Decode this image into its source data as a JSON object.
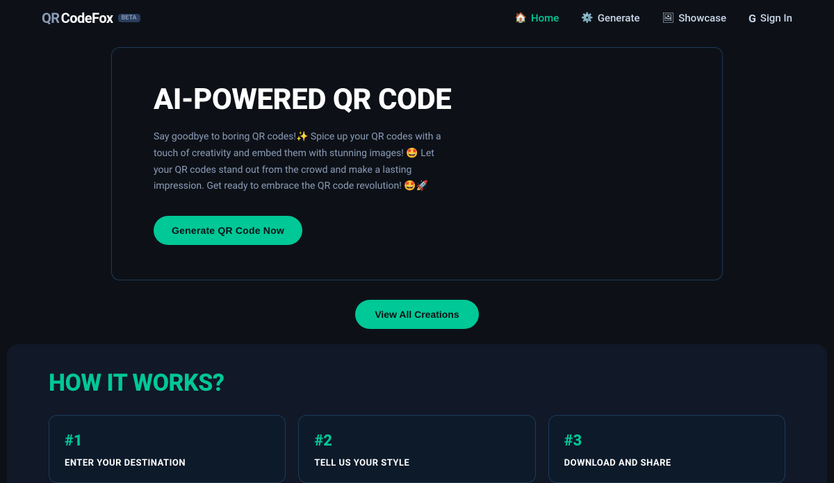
{
  "navbar": {
    "logo": {
      "qr": "QR",
      "codefox": "CodeFox",
      "beta": "Beta"
    },
    "links": [
      {
        "id": "home",
        "label": "Home",
        "icon": "🏠",
        "active": true
      },
      {
        "id": "generate",
        "label": "Generate",
        "icon": "⚙️",
        "active": false
      },
      {
        "id": "showcase",
        "label": "Showcase",
        "icon": "🖼",
        "active": false
      },
      {
        "id": "signin",
        "label": "Sign In",
        "icon": "G",
        "active": false
      }
    ]
  },
  "hero": {
    "title": "AI-POWERED QR CODE",
    "description": "Say goodbye to boring QR codes!✨ Spice up your QR codes with a touch of creativity and embed them with stunning images! 🤩 Let your QR codes stand out from the crowd and make a lasting impression. Get ready to embrace the QR code revolution! 🤩🚀",
    "cta_label": "Generate QR Code Now"
  },
  "view_all": {
    "label": "View All Creations"
  },
  "how_it_works": {
    "title": "HOW IT WORKS?",
    "steps": [
      {
        "number": "#1",
        "label": "ENTER YOUR DESTINATION"
      },
      {
        "number": "#2",
        "label": "TELL US YOUR STYLE"
      },
      {
        "number": "#3",
        "label": "DOWNLOAD AND SHARE"
      }
    ]
  }
}
